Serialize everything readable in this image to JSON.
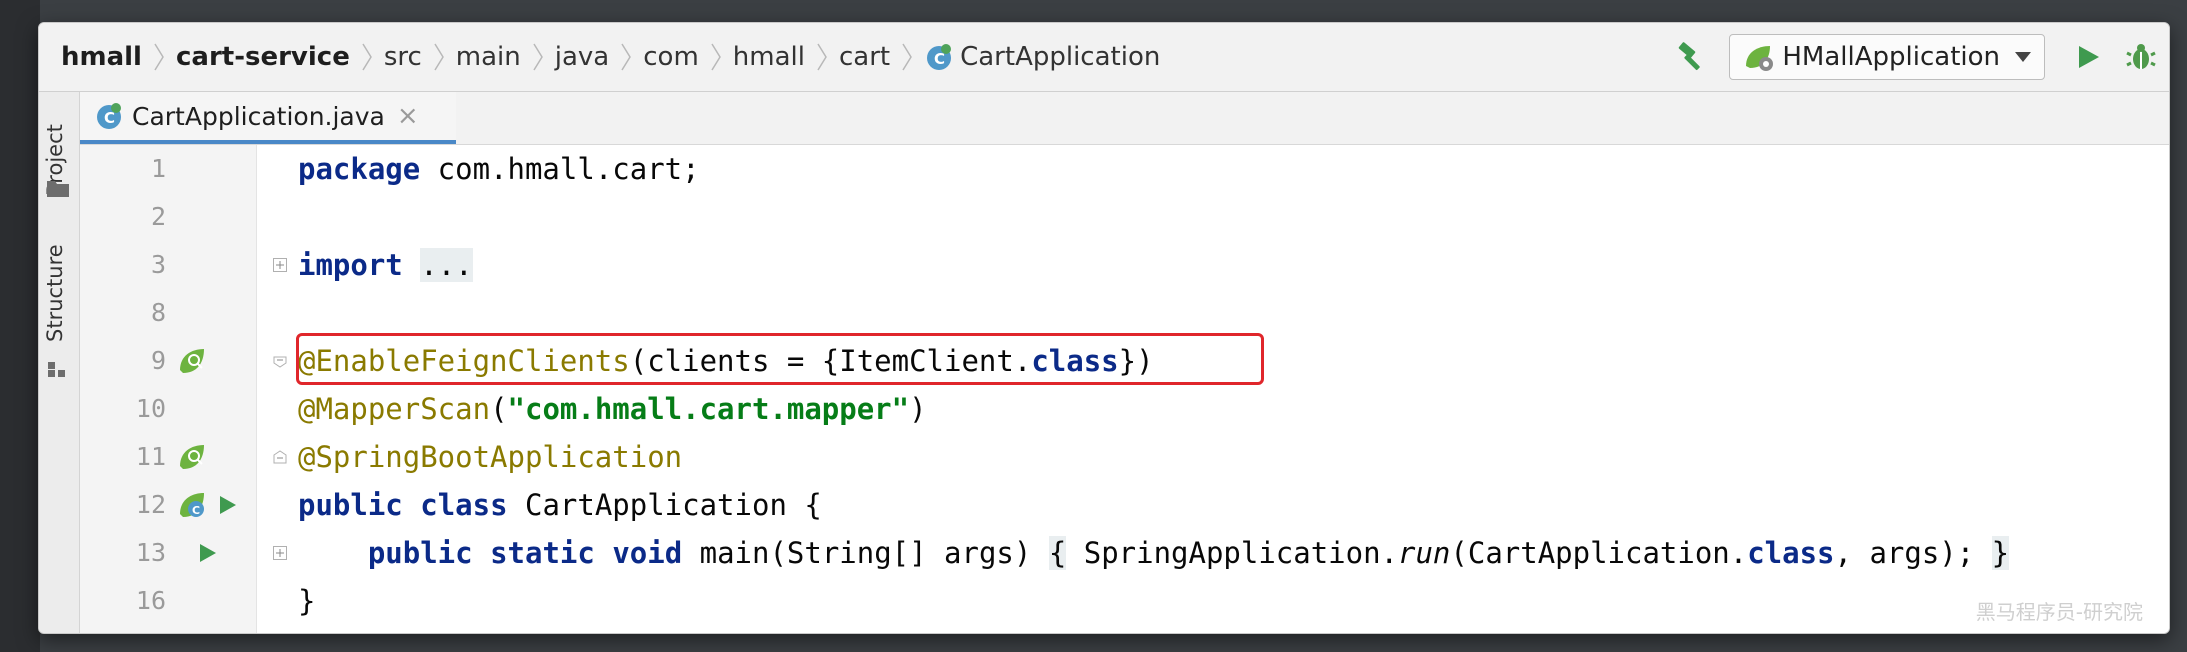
{
  "breadcrumbs": [
    "hmall",
    "cart-service",
    "src",
    "main",
    "java",
    "com",
    "hmall",
    "cart",
    "CartApplication"
  ],
  "run_config": {
    "label": "HMallApplication"
  },
  "tool_windows": {
    "project_label": "Project",
    "structure_label": "Structure"
  },
  "editor_tab": {
    "label": "CartApplication.java",
    "close_glyph": "×"
  },
  "lines": {
    "l1": {
      "num": "1",
      "t1": "package",
      "t2": " com.hmall.cart;"
    },
    "l2": {
      "num": "2"
    },
    "l3": {
      "num": "3",
      "t1": "import",
      "t2": " ",
      "t3": "..."
    },
    "l4": {
      "num": "8"
    },
    "l5": {
      "num": "9",
      "t1": "@EnableFeignClients",
      "t2": "(clients = {ItemClient.",
      "t3": "class",
      "t4": "})"
    },
    "l6": {
      "num": "10",
      "t1": "@MapperScan",
      "t2": "(",
      "t3": "\"com.hmall.cart.mapper\"",
      "t4": ")"
    },
    "l7": {
      "num": "11",
      "t1": "@SpringBootApplication"
    },
    "l8": {
      "num": "12",
      "t1": "public",
      "t2": " ",
      "t3": "class",
      "t4": " CartApplication {"
    },
    "l9": {
      "num": "13",
      "t0": "    ",
      "t1": "public",
      "t2": " ",
      "t3": "static",
      "t4": " ",
      "t5": "void",
      "t6": " main(String[] args) ",
      "t7": "{",
      "t8": " SpringApplication.",
      "t9": "run",
      "t10": "(CartApplication.",
      "t11": "class",
      "t12": ", args); ",
      "t13": "}"
    },
    "l10": {
      "num": "16",
      "t1": "}"
    }
  },
  "watermark": "黑马程序员-研究院",
  "colors": {
    "keyword": "#0b2a88",
    "annotation": "#8a7a00",
    "string": "#067d17",
    "highlight_border": "#e0262b",
    "tab_underline": "#4a88c7"
  },
  "icons": [
    "class-icon",
    "hammer-icon",
    "spring-run-config-icon",
    "run-icon",
    "debug-icon",
    "folder-icon",
    "structure-icon",
    "spring-bean-icon",
    "run-gutter-icon",
    "fold-icon"
  ]
}
